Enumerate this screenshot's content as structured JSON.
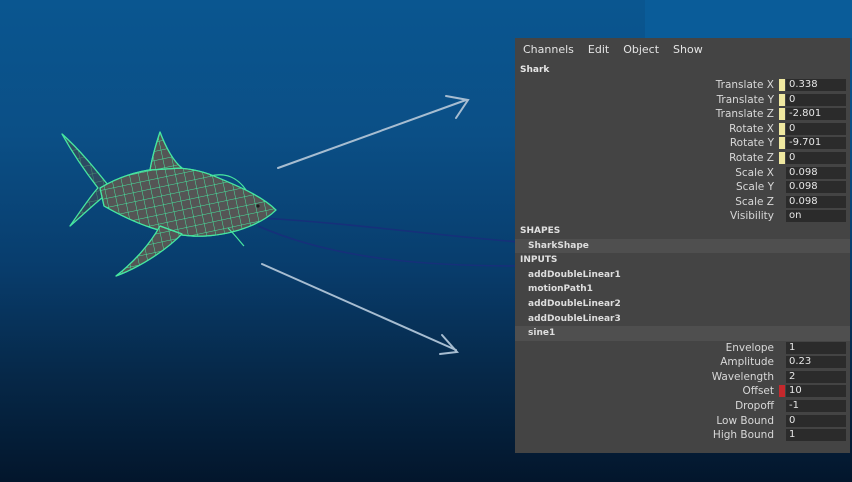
{
  "menu": {
    "channels": "Channels",
    "edit": "Edit",
    "object": "Object",
    "show": "Show"
  },
  "node": {
    "title": "Shark",
    "attributes": [
      {
        "label": "Translate X",
        "value": "0.338",
        "key": "yellow"
      },
      {
        "label": "Translate Y",
        "value": "0",
        "key": "yellow"
      },
      {
        "label": "Translate Z",
        "value": "-2.801",
        "key": "yellow"
      },
      {
        "label": "Rotate X",
        "value": "0",
        "key": "yellow"
      },
      {
        "label": "Rotate Y",
        "value": "-9.701",
        "key": "yellow"
      },
      {
        "label": "Rotate Z",
        "value": "0",
        "key": "yellow"
      },
      {
        "label": "Scale X",
        "value": "0.098",
        "key": "none"
      },
      {
        "label": "Scale Y",
        "value": "0.098",
        "key": "none"
      },
      {
        "label": "Scale Z",
        "value": "0.098",
        "key": "none"
      },
      {
        "label": "Visibility",
        "value": "on",
        "key": "none"
      }
    ]
  },
  "shapes": {
    "header": "SHAPES",
    "items": [
      "SharkShape"
    ]
  },
  "inputs": {
    "header": "INPUTS",
    "items": [
      "addDoubleLinear1",
      "motionPath1",
      "addDoubleLinear2",
      "addDoubleLinear3",
      "sine1"
    ]
  },
  "sine_attributes": [
    {
      "label": "Envelope",
      "value": "1",
      "key": "none"
    },
    {
      "label": "Amplitude",
      "value": "0.23",
      "key": "none"
    },
    {
      "label": "Wavelength",
      "value": "2",
      "key": "none"
    },
    {
      "label": "Offset",
      "value": "10",
      "key": "red"
    },
    {
      "label": "Dropoff",
      "value": "-1",
      "key": "none"
    },
    {
      "label": "Low Bound",
      "value": "0",
      "key": "none"
    },
    {
      "label": "High Bound",
      "value": "1",
      "key": "none"
    }
  ],
  "colors": {
    "wireframe": "#46e6a0",
    "panel_bg": "#444444",
    "field_bg": "#2b2b2b",
    "key_yellow": "#efe8a0",
    "key_red": "#c5282c"
  }
}
